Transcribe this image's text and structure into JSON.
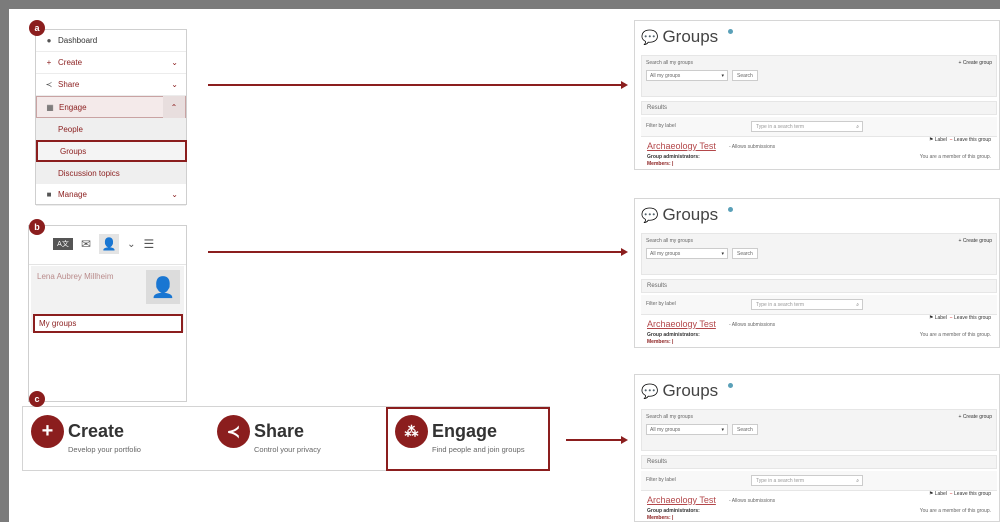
{
  "badges": {
    "a": "a",
    "b": "b",
    "c": "c"
  },
  "nav_menu": {
    "items": [
      {
        "icon": "speedometer-icon",
        "label": "Dashboard"
      },
      {
        "icon": "plus-icon",
        "label": "Create"
      },
      {
        "icon": "share-icon",
        "label": "Share"
      },
      {
        "icon": "people-icon",
        "label": "Engage"
      },
      {
        "icon": "briefcase-icon",
        "label": "Manage"
      }
    ],
    "engage_sub": [
      "People",
      "Groups",
      "Discussion topics"
    ]
  },
  "user_menu": {
    "user_name": "Lena Aubrey Millheim",
    "groups_link": "My groups"
  },
  "dashboard": {
    "blocks": [
      {
        "title": "Create",
        "desc": "Develop your portfolio",
        "icon": "plus-icon"
      },
      {
        "title": "Share",
        "desc": "Control your privacy",
        "icon": "share-icon"
      },
      {
        "title": "Engage",
        "desc": "Find people and join groups",
        "icon": "people-icon"
      }
    ]
  },
  "groups_page": {
    "title": "Groups",
    "search_label": "Search all my groups",
    "select_value": "All my groups",
    "search_button": "Search",
    "create_link": "Create group",
    "results_heading": "Results",
    "filter_label": "Filter by label",
    "filter_placeholder": "Type in a search term",
    "group_name": "Archaeology Test",
    "group_allows": "- Allows submissions",
    "admins_label": "Group administrators:",
    "members_label": "Members: |",
    "label_action": "Label",
    "leave_action": "Leave this group",
    "member_status": "You are a member of this group."
  },
  "colors": {
    "accent": "#8b1e1e",
    "info_dot": "#5aa0b8"
  }
}
